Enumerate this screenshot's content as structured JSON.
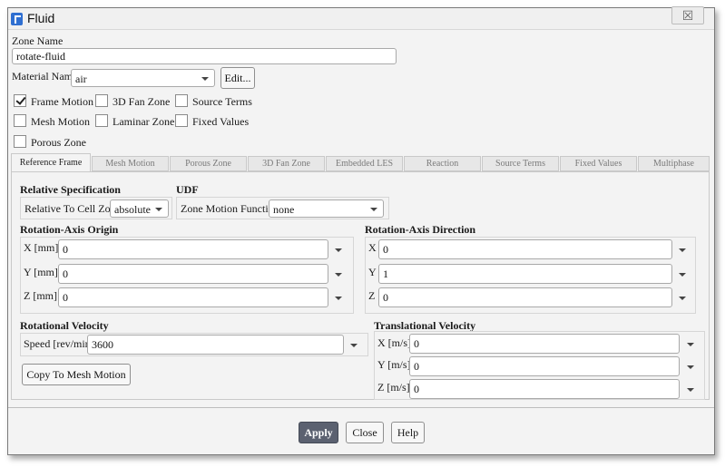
{
  "window": {
    "title": "Fluid",
    "close_glyph": "☒"
  },
  "zone": {
    "label": "Zone Name",
    "value": "rotate-fluid"
  },
  "material": {
    "label": "Material Name",
    "value": "air",
    "edit_label": "Edit..."
  },
  "options": [
    {
      "label": "Frame Motion",
      "checked": true
    },
    {
      "label": "3D Fan Zone",
      "checked": false
    },
    {
      "label": "Source Terms",
      "checked": false
    },
    {
      "label": "Mesh Motion",
      "checked": false
    },
    {
      "label": "Laminar Zone",
      "checked": false
    },
    {
      "label": "Fixed Values",
      "checked": false
    },
    {
      "label": "Porous Zone",
      "checked": false
    }
  ],
  "tabs": [
    "Reference Frame",
    "Mesh Motion",
    "Porous Zone",
    "3D Fan Zone",
    "Embedded LES",
    "Reaction",
    "Source Terms",
    "Fixed Values",
    "Multiphase"
  ],
  "active_tab": "Reference Frame",
  "relative": {
    "title": "Relative Specification",
    "label": "Relative To Cell Zone",
    "value": "absolute"
  },
  "udf": {
    "title": "UDF",
    "label": "Zone Motion Function",
    "value": "none"
  },
  "origin": {
    "title": "Rotation-Axis Origin",
    "x_label": "X [mm]",
    "x_value": "0",
    "y_label": "Y [mm]",
    "y_value": "0",
    "z_label": "Z [mm]",
    "z_value": "0"
  },
  "direction": {
    "title": "Rotation-Axis Direction",
    "x_label": "X",
    "x_value": "0",
    "y_label": "Y",
    "y_value": "1",
    "z_label": "Z",
    "z_value": "0"
  },
  "rotational": {
    "title": "Rotational Velocity",
    "label": "Speed [rev/min]",
    "value": "3600",
    "copy_label": "Copy To Mesh Motion"
  },
  "translational": {
    "title": "Translational Velocity",
    "x_label": "X [m/s]",
    "x_value": "0",
    "y_label": "Y [m/s]",
    "y_value": "0",
    "z_label": "Z [m/s]",
    "z_value": "0"
  },
  "footer": {
    "apply": "Apply",
    "close": "Close",
    "help": "Help"
  }
}
